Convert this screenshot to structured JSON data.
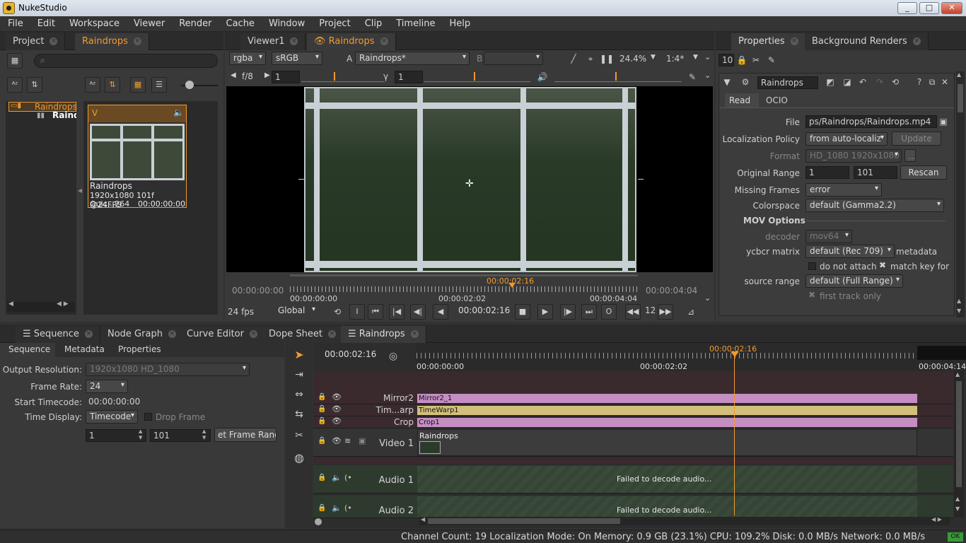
{
  "window": {
    "title": "NukeStudio",
    "min": "_",
    "max": "□",
    "close": "✕"
  },
  "menu": [
    "File",
    "Edit",
    "Workspace",
    "Viewer",
    "Render",
    "Cache",
    "Window",
    "Project",
    "Clip",
    "Timeline",
    "Help"
  ],
  "left_tabs": {
    "project": "Project",
    "raindrops": "Raindrops"
  },
  "bin": {
    "tree_item": "Raindrops",
    "tree_sub": "Raindrops",
    "clip_badge": "V",
    "clip_name": "Raindrops",
    "clip_info": "1920x1080 101f @24FPS",
    "clip_codec": "Quic...264",
    "clip_tc": "00:00:00:00"
  },
  "viewer_tabs": {
    "viewer1": "Viewer1",
    "raindrops": "Raindrops"
  },
  "viewer": {
    "channels": "rgba",
    "colorspace": "sRGB",
    "a_label": "A",
    "a_input": "Raindrops*",
    "b_label": "B",
    "zoom": "24.4%",
    "ratio": "1:4*",
    "fstop": "f/8",
    "gain": "1",
    "gamma_label": "γ",
    "gamma": "1",
    "tc_left": "00:00:00:00",
    "tc_right": "00:00:04:04",
    "tc_current": "00:00:02:16",
    "scale_start": "00:00:00:00",
    "scale_mid": "00:00:02:02",
    "scale_end": "00:00:04:04",
    "fps": "24 fps",
    "global": "Global",
    "tc_display": "00:00:02:16",
    "step": "12",
    "i_btn": "I",
    "o_btn": "O"
  },
  "props_tabs": {
    "properties": "Properties",
    "bg_renders": "Background Renders"
  },
  "props": {
    "count": "10",
    "node_name": "Raindrops",
    "tab_read": "Read",
    "tab_ocio": "OCIO",
    "file_label": "File",
    "file_value": "ps/Raindrops/Raindrops.mp4",
    "loc_label": "Localization Policy",
    "loc_value": "from auto-localiz",
    "update_btn": "Update",
    "format_label": "Format",
    "format_value": "HD_1080 1920x1080",
    "range_label": "Original Range",
    "range_start": "1",
    "range_end": "101",
    "rescan_btn": "Rescan",
    "missing_label": "Missing Frames",
    "missing_value": "error",
    "cs_label": "Colorspace",
    "cs_value": "default (Gamma2.2)",
    "mov_header": "MOV Options",
    "decoder_label": "decoder",
    "decoder_value": "mov64",
    "ycbcr_label": "ycbcr matrix",
    "ycbcr_value": "default (Rec 709)",
    "metadata_label": "metadata",
    "attach_label": "do not attach",
    "matchkey_label": "match key for",
    "srcrange_label": "source range",
    "srcrange_value": "default (Full Range)",
    "firsttrack_label": "first track only"
  },
  "bottom_tabs": {
    "sequence": "Sequence",
    "node_graph": "Node Graph",
    "curve_editor": "Curve Editor",
    "dope_sheet": "Dope Sheet",
    "raindrops": "Raindrops"
  },
  "seq_tabs": {
    "sequence": "Sequence",
    "metadata": "Metadata",
    "properties": "Properties"
  },
  "seq": {
    "outres_label": "Output Resolution:",
    "outres_value": "1920x1080 HD_1080",
    "fr_label": "Frame Rate:",
    "fr_value": "24",
    "stc_label": "Start Timecode:",
    "stc_value": "00:00:00:00",
    "td_label": "Time Display:",
    "td_value": "Timecode",
    "drop_label": "Drop Frame",
    "in_value": "1",
    "out_value": "101",
    "setrange_btn": "et Frame Rang"
  },
  "timeline": {
    "current_tc": "00:00:02:16",
    "playhead_tc": "00:00:02:16",
    "ruler_start": "00:00:00:00",
    "ruler_mid": "00:00:02:02",
    "ruler_end": "00:00:04:14"
  },
  "tracks": {
    "mirror2": "Mirror2",
    "timewarp": "Tim...arp",
    "crop": "Crop",
    "video1": "Video 1",
    "audio1": "Audio 1",
    "audio2": "Audio 2",
    "clip_mirror": "Mirror2_1",
    "clip_timewarp": "TimeWarp1",
    "clip_crop": "Crop1",
    "clip_video": "Raindrops",
    "audio_fail1": "Failed to decode audio...",
    "audio_fail2": "Failed to decode audio..."
  },
  "status": {
    "text": "Channel Count: 19 Localization Mode: On Memory: 0.9 GB (23.1%) CPU: 109.2% Disk: 0.0 MB/s Network: 0.0 MB/s",
    "ok": "OK"
  },
  "colors": {
    "accent": "#f29a2e",
    "mirror_clip": "#c58ec3",
    "timewarp_clip": "#d2c07a",
    "crop_clip": "#c58ec3"
  }
}
